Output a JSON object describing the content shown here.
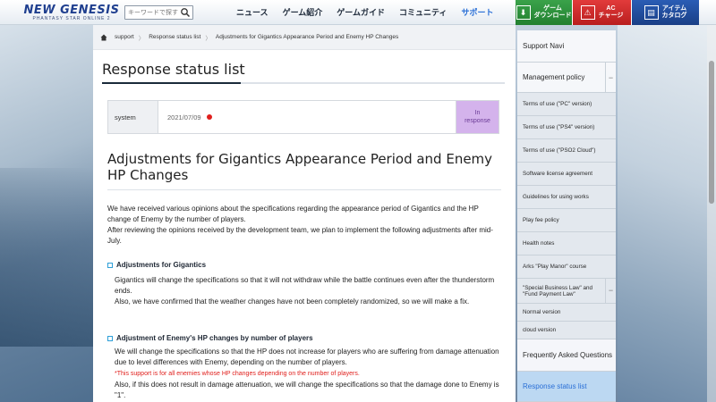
{
  "header": {
    "logo_main": "NEW GENESIS",
    "logo_sub": "PHANTASY STAR ONLINE 2",
    "search_placeholder": "キーワードで探す",
    "nav": [
      {
        "label": "ニュース"
      },
      {
        "label": "ゲーム紹介"
      },
      {
        "label": "ゲームガイド"
      },
      {
        "label": "コミュニティ"
      },
      {
        "label": "サポート"
      }
    ],
    "buttons": {
      "download_line1": "ゲーム",
      "download_line2": "ダウンロード",
      "ac_line1": "AC",
      "ac_line2": "チャージ",
      "catalog_line1": "アイテム",
      "catalog_line2": "カタログ"
    }
  },
  "breadcrumb": {
    "items": [
      "support",
      "Response status list",
      "Adjustments for Gigantics Appearance Period and Enemy HP Changes"
    ]
  },
  "page_title": "Response status list",
  "status": {
    "category": "system",
    "date": "2021/07/09",
    "badge_line1": "In",
    "badge_line2": "response",
    "accent": "#d4b3ec"
  },
  "article": {
    "title": "Adjustments for Gigantics Appearance Period and Enemy HP Changes",
    "intro_1": "We have received various opinions about the specifications regarding the appearance period of Gigantics and the HP change of Enemy by the number of players.",
    "intro_2": "After reviewing the opinions received by the development team, we plan to implement the following adjustments after mid-July.",
    "section1_title": "Adjustments for Gigantics",
    "section1_p1": "Gigantics will change the specifications so that it will not withdraw while the battle continues even after the thunderstorm ends.",
    "section1_p2": "Also, we have confirmed that the weather changes have not been completely randomized, so we will make a fix.",
    "section2_title": "Adjustment of Enemy's HP changes by number of players",
    "section2_p1": "We will change the specifications so that the HP does not increase for players who are suffering from damage attenuation due to level differences with Enemy, depending on the number of players.",
    "section2_note": "*This support is for all enemies whose HP changes depending on the number of players.",
    "section2_p2": "Also, if this does not result in damage attenuation, we will change the specifications so that the damage done to Enemy is \"1\"."
  },
  "sidebar": {
    "support_navi": "Support Navi",
    "management_policy": "Management policy",
    "items": [
      "Terms of use (\"PC\" version)",
      "Terms of use (\"PS4\" version)",
      "Terms of use (\"PSO2 Cloud\")",
      "Software license agreement",
      "Guidelines for using works",
      "Play fee policy",
      "Health notes",
      "Arks \"Play Manor\" course"
    ],
    "special_law": "\"Special Business Law\" and \"Fund Payment Law\"",
    "normal_version": "Normal version",
    "cloud_version": "cloud version",
    "faq": "Frequently Asked Questions",
    "response_status": "Response status list"
  }
}
